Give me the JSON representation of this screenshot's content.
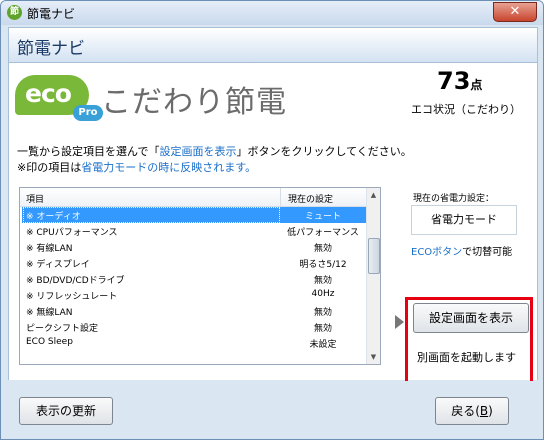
{
  "window": {
    "title": "節電ナビ",
    "close_glyph": "✕",
    "app_icon_glyph": "節"
  },
  "header": {
    "title": "節電ナビ"
  },
  "brand": {
    "eco": "eco",
    "pro": "Pro",
    "title": "こだわり節電"
  },
  "score": {
    "value": "73",
    "unit": "点",
    "label": "エコ状況（こだわり）"
  },
  "instructions": {
    "line1_before": "一覧から設定項目を選んで「",
    "line1_link": "設定画面を表示",
    "line1_after": "」ボタンをクリックしてください。",
    "line2_before": "※印の項目は",
    "line2_link": "省電力モードの時に反映されます。"
  },
  "list": {
    "header": {
      "item": "項目",
      "setting": "現在の設定"
    },
    "rows": [
      {
        "item": "※ オーディオ",
        "value": "ミュート",
        "selected": true
      },
      {
        "item": "※ CPUパフォーマンス",
        "value": "低パフォーマンス",
        "selected": false
      },
      {
        "item": "※ 有線LAN",
        "value": "無効",
        "selected": false
      },
      {
        "item": "※ ディスプレイ",
        "value": "明るさ5/12",
        "selected": false
      },
      {
        "item": "※ BD/DVD/CDドライブ",
        "value": "無効",
        "selected": false
      },
      {
        "item": "※ リフレッシュレート",
        "value": "40Hz",
        "selected": false
      },
      {
        "item": "※ 無線LAN",
        "value": "無効",
        "selected": false
      },
      {
        "item": "ピークシフト設定",
        "value": "無効",
        "selected": false
      },
      {
        "item": "ECO Sleep",
        "value": "未設定",
        "selected": false
      }
    ]
  },
  "power": {
    "current_label": "現在の省電力設定：",
    "current_value": "省電力モード",
    "switch_link": "ECOボタン",
    "switch_text": "で切替可能"
  },
  "actions": {
    "open_settings": "設定画面を表示",
    "open_note": "別画面を起動します",
    "refresh": "表示の更新",
    "back": "戻る(",
    "back_key": "B",
    "back_end": ")"
  },
  "colors": {
    "accent_blue": "#1a6fc9",
    "selection": "#3399ff",
    "highlight_frame": "#e60012",
    "eco_green": "#7ab83a"
  }
}
